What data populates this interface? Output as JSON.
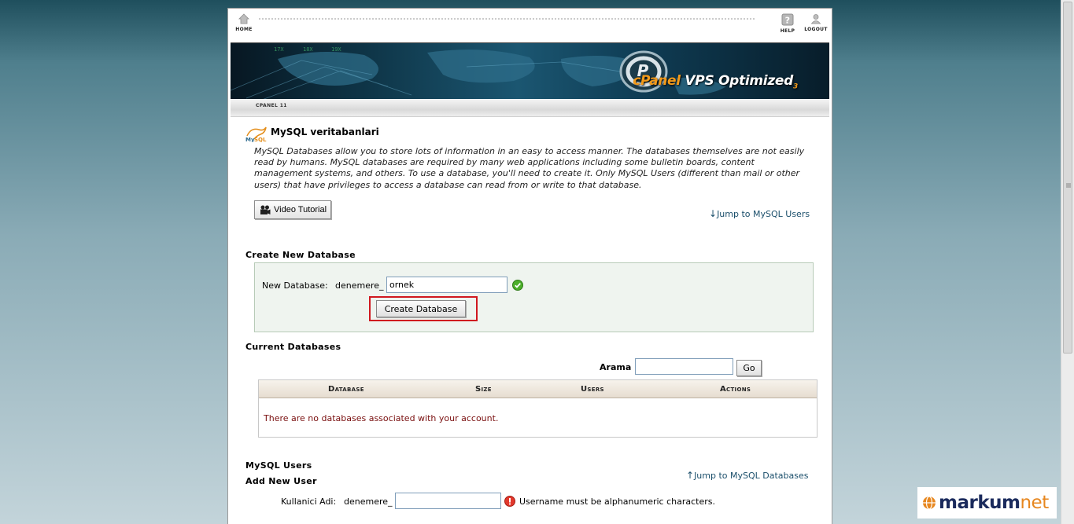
{
  "topnav": {
    "home_label": "HOME",
    "help_label": "HELP",
    "logout_label": "LOGOUT"
  },
  "banner": {
    "brand_cp": "cPanel",
    "brand_rest": " VPS Optimized",
    "brand_version": "3"
  },
  "breadcrumb": "CPANEL 11",
  "page": {
    "title": "MySQL veritabanlari",
    "description": "MySQL Databases allow you to store lots of information in an easy to access manner. The databases themselves are not easily read by humans. MySQL databases are required by many web applications including some bulletin boards, content management systems, and others. To use a database, you'll need to create it. Only MySQL Users (different than mail or other users) that have privileges to access a database can read from or write to that database.",
    "video_tutorial_label": "Video Tutorial",
    "jump_users_label": "Jump to MySQL Users"
  },
  "create_db": {
    "heading": "Create New Database",
    "label": "New Database:",
    "prefix": "denemere_",
    "value": "ornek",
    "button_label": "Create Database"
  },
  "current_dbs": {
    "heading": "Current Databases",
    "search_label": "Arama",
    "search_value": "",
    "go_label": "Go",
    "columns": [
      "Database",
      "Size",
      "Users",
      "Actions"
    ],
    "empty_message": "There are no databases associated with your account."
  },
  "mysql_users": {
    "heading": "MySQL Users",
    "subheading": "Add New User",
    "jump_dbs_label": "Jump to MySQL Databases",
    "user_label": "Kullanici Adi:",
    "user_prefix": "denemere_",
    "user_value": "",
    "error_message": "Username must be alphanumeric characters."
  },
  "watermark": {
    "main": "markum",
    "accent": "net"
  },
  "colors": {
    "link": "#1b4f6b",
    "error_text": "#7a1010",
    "highlight": "#d0181f",
    "create_box_bg": "#eff4ef"
  }
}
